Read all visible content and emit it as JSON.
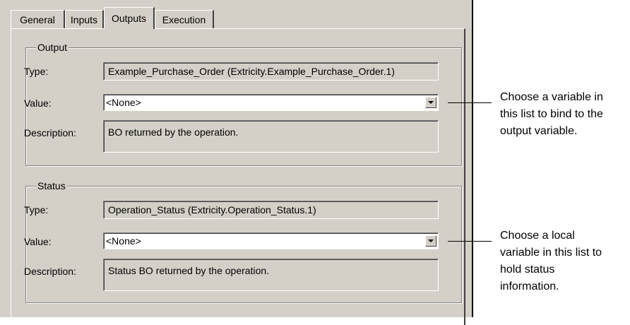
{
  "tabs": [
    {
      "label": "General"
    },
    {
      "label": "Inputs"
    },
    {
      "label": "Outputs",
      "active": true
    },
    {
      "label": "Execution"
    }
  ],
  "output_group": {
    "title": "Output",
    "type_label": "Type:",
    "type_value": "Example_Purchase_Order  (Extricity.Example_Purchase_Order.1)",
    "value_label": "Value:",
    "value_selected": "<None>",
    "description_label": "Description:",
    "description_value": "BO returned by the operation."
  },
  "status_group": {
    "title": "Status",
    "type_label": "Type:",
    "type_value": "Operation_Status  (Extricity.Operation_Status.1)",
    "value_label": "Value:",
    "value_selected": "<None>",
    "description_label": "Description:",
    "description_value": "Status BO returned by the operation."
  },
  "callouts": [
    {
      "text": "Choose a variable in\nthis list to bind to the\noutput variable."
    },
    {
      "text": "Choose a local\nvariable in this list to\nhold status\ninformation."
    }
  ]
}
